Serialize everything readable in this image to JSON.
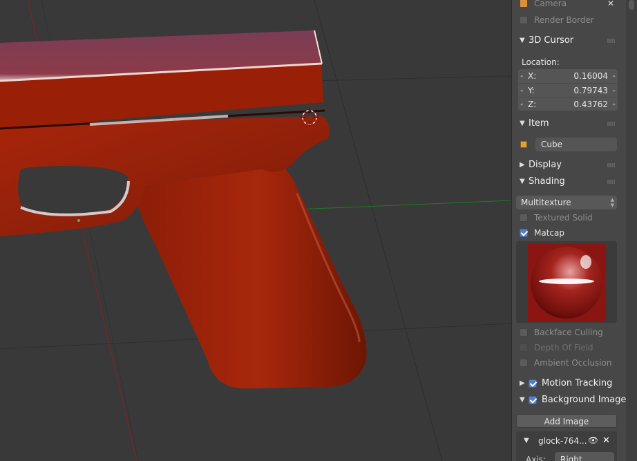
{
  "panel": {
    "camera_label": "Camera",
    "render_border_label": "Render Border",
    "cursor_section": {
      "title": "3D Cursor",
      "location_label": "Location:",
      "x_label": "X:",
      "x_value": "0.16004",
      "y_label": "Y:",
      "y_value": "0.79743",
      "z_label": "Z:",
      "z_value": "0.43762"
    },
    "item_section": {
      "title": "Item",
      "name_value": "Cube"
    },
    "display_section": {
      "title": "Display"
    },
    "shading_section": {
      "title": "Shading",
      "mode_value": "Multitexture",
      "textured_solid_label": "Textured Solid",
      "matcap_label": "Matcap",
      "matcap_enabled": true,
      "backface_culling_label": "Backface Culling",
      "depth_of_field_label": "Depth Of Field",
      "ambient_occlusion_label": "Ambient Occlusion"
    },
    "motion_tracking_section": {
      "title": "Motion Tracking",
      "enabled": true
    },
    "background_image_section": {
      "title": "Background Image",
      "enabled": true,
      "add_image_label": "Add Image",
      "image_name": "glock-764...",
      "axis_label": "Axis:",
      "axis_value": "Right"
    }
  },
  "icons": [
    "cube-icon",
    "close-icon",
    "eye-icon",
    "dropdown-arrows-icon",
    "checkbox-icon",
    "disclosure-triangle-icon"
  ],
  "colors": {
    "model_red": "#9e1e06",
    "accent_blue": "#5680c2",
    "panel_bg": "#474747",
    "viewport_bg": "#393939"
  }
}
